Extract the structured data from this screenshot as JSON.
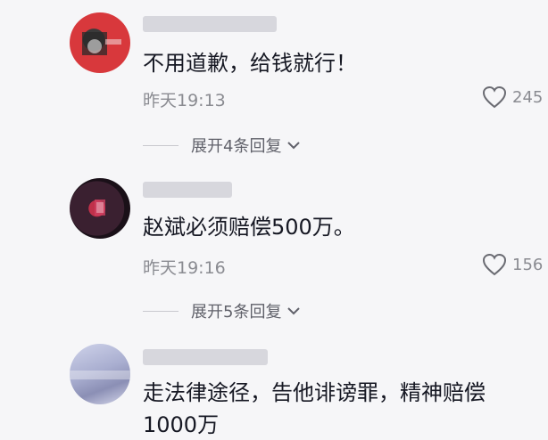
{
  "comments": [
    {
      "text": "不用道歉，给钱就行！",
      "time": "昨天19:13",
      "likes": "245",
      "replies_label": "展开4条回复"
    },
    {
      "text": "赵斌必须赔偿500万。",
      "time": "昨天19:16",
      "likes": "156",
      "replies_label": "展开5条回复"
    },
    {
      "text_line1": "走法律途径，告他诽谤罪，精神赔偿",
      "text_line2": "1000万"
    }
  ],
  "colors": {
    "background": "#f6f6f8",
    "primary_text": "#161823",
    "secondary_text": "#8a8b91"
  },
  "icons": {
    "like": "heart-outline-icon",
    "expand": "chevron-down-icon"
  }
}
